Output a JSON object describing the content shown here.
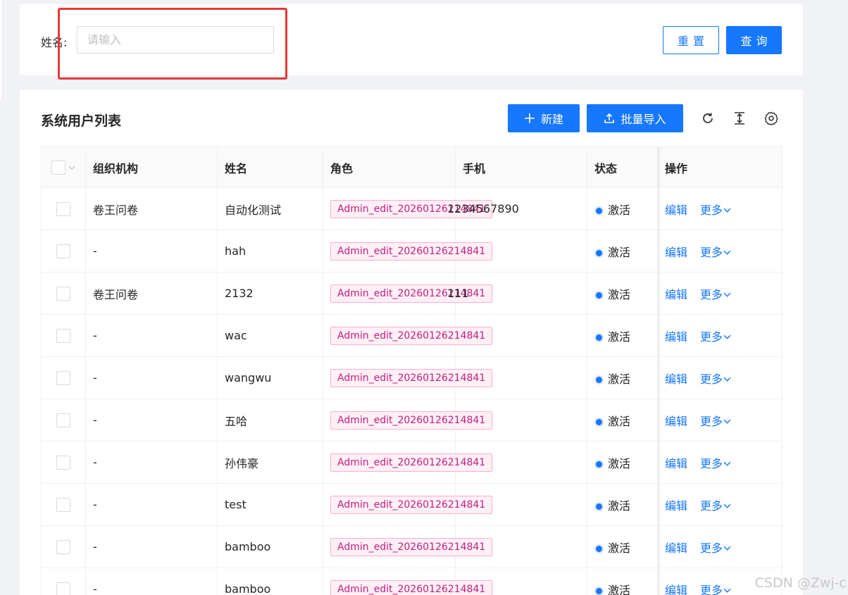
{
  "search": {
    "label": "姓名:",
    "placeholder": "请输入",
    "value": "",
    "reset_label": "重置",
    "query_label": "查询"
  },
  "list": {
    "title": "系统用户列表",
    "new_label": "新建",
    "import_label": "批量导入",
    "columns": [
      "组织机构",
      "姓名",
      "角色",
      "手机",
      "状态",
      "操作"
    ],
    "rows": [
      {
        "org": "卷王问卷",
        "name": "自动化测试",
        "role": "Admin_edit_20260126214841",
        "phone": "1234567890",
        "status": "激活"
      },
      {
        "org": "-",
        "name": "hah",
        "role": "Admin_edit_20260126214841",
        "phone": "",
        "status": "激活"
      },
      {
        "org": "卷王问卷",
        "name": "2132",
        "role": "Admin_edit_20260126214841",
        "phone": "111",
        "status": "激活"
      },
      {
        "org": "-",
        "name": "wac",
        "role": "Admin_edit_20260126214841",
        "phone": "",
        "status": "激活"
      },
      {
        "org": "-",
        "name": "wangwu",
        "role": "Admin_edit_20260126214841",
        "phone": "",
        "status": "激活"
      },
      {
        "org": "-",
        "name": "五哈",
        "role": "Admin_edit_20260126214841",
        "phone": "",
        "status": "激活"
      },
      {
        "org": "-",
        "name": "孙伟豪",
        "role": "Admin_edit_20260126214841",
        "phone": "",
        "status": "激活"
      },
      {
        "org": "-",
        "name": "test",
        "role": "Admin_edit_20260126214841",
        "phone": "",
        "status": "激活"
      },
      {
        "org": "-",
        "name": "bamboo",
        "role": "Admin_edit_20260126214841",
        "phone": "",
        "status": "激活"
      },
      {
        "org": "-",
        "name": "bamboo",
        "role": "Admin_edit_20260126214841",
        "phone": "",
        "status": "激活"
      }
    ],
    "actions": {
      "edit": "编辑",
      "more": "更多"
    }
  },
  "watermark": "CSDN @Zwj-c",
  "colors": {
    "primary": "#1677ff",
    "tag": "#c41d7f",
    "highlight": "#e53935"
  },
  "icons": [
    "plus-icon",
    "upload-icon",
    "refresh-icon",
    "column-height-icon",
    "setting-icon",
    "chevron-down-icon"
  ]
}
